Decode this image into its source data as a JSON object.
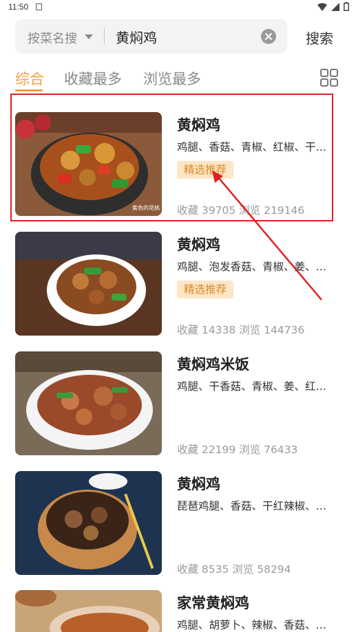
{
  "status": {
    "time": "11:50"
  },
  "search": {
    "category": "按菜名搜",
    "query": "黄焖鸡",
    "button": "搜索"
  },
  "tabs": [
    {
      "label": "综合",
      "active": true
    },
    {
      "label": "收藏最多",
      "active": false
    },
    {
      "label": "浏览最多",
      "active": false
    }
  ],
  "colors": {
    "accent": "#f2a23a",
    "badge_bg": "#fde5c6",
    "badge_text": "#d88a2a",
    "highlight": "#e02020"
  },
  "recipes": [
    {
      "title": "黄焖鸡",
      "ingredients": "鸡腿、香菇、青椒、红椒、干…",
      "badge": "精选推荐",
      "stats": "收藏 39705 浏览 219146",
      "watermark": "紫色的花桃"
    },
    {
      "title": "黄焖鸡",
      "ingredients": "鸡腿、泡发香菇、青椒、姜、…",
      "badge": "精选推荐",
      "stats": "收藏 14338 浏览 144736"
    },
    {
      "title": "黄焖鸡米饭",
      "ingredients": "鸡腿、干香菇、青椒、姜、红…",
      "badge": "",
      "stats": "收藏 22199 浏览 76433"
    },
    {
      "title": "黄焖鸡",
      "ingredients": "琵琶鸡腿、香菇、干红辣椒、…",
      "badge": "",
      "stats": "收藏 8535 浏览 58294"
    },
    {
      "title": "家常黄焖鸡",
      "ingredients": "鸡腿、胡萝卜、辣椒、香菇、…",
      "badge": "",
      "stats": ""
    }
  ]
}
